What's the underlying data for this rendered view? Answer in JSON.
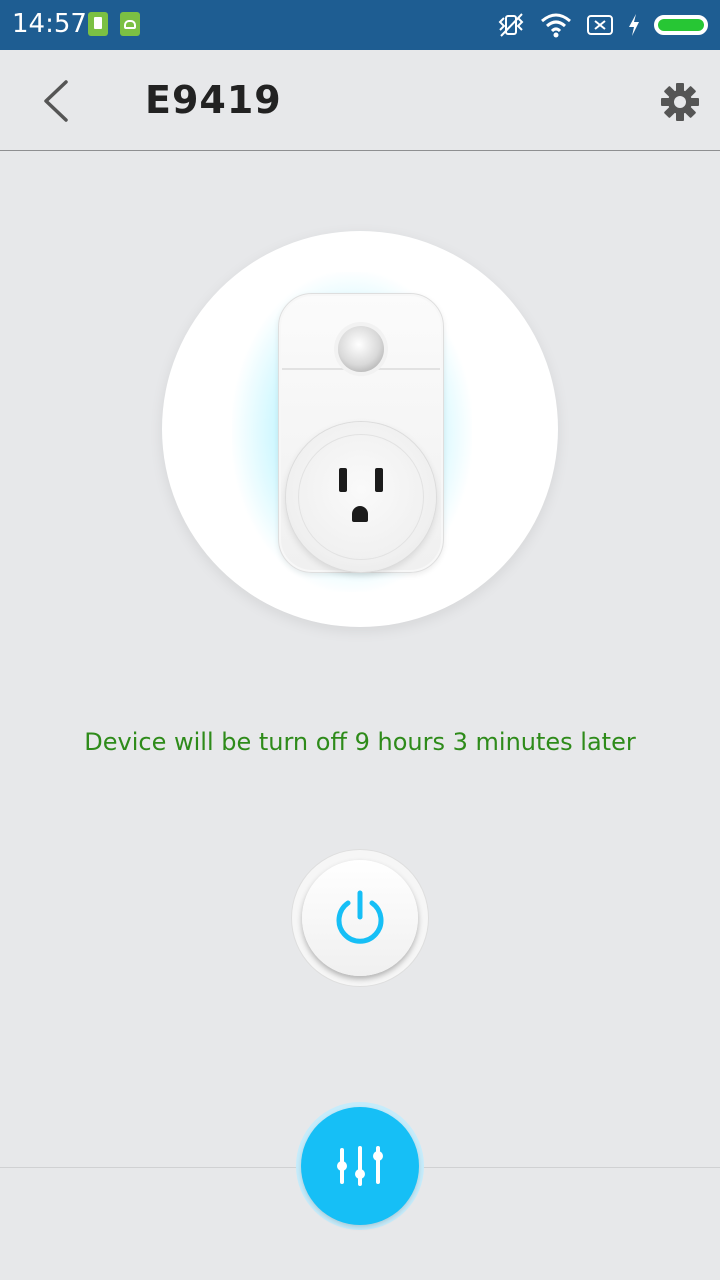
{
  "status_bar": {
    "time": "14:57",
    "icons": [
      "sim-card-icon",
      "android-icon",
      "vibrate-off-icon",
      "wifi-icon",
      "no-sim-icon",
      "charging-icon",
      "battery-icon"
    ],
    "battery_level": 1.0,
    "battery_color": "#27c634"
  },
  "header": {
    "back_icon": "chevron-left-icon",
    "title": "E9419",
    "settings_icon": "gear-icon"
  },
  "device": {
    "image": "smart-plug-icon",
    "glow_color": "#64e6ff"
  },
  "status": {
    "message": "Device will be turn off 9 hours 3 minutes later",
    "color": "#2e8b1a"
  },
  "power_button": {
    "icon": "power-icon",
    "color": "#16bff6"
  },
  "fab": {
    "icon": "sliders-icon",
    "color": "#16bff6"
  }
}
